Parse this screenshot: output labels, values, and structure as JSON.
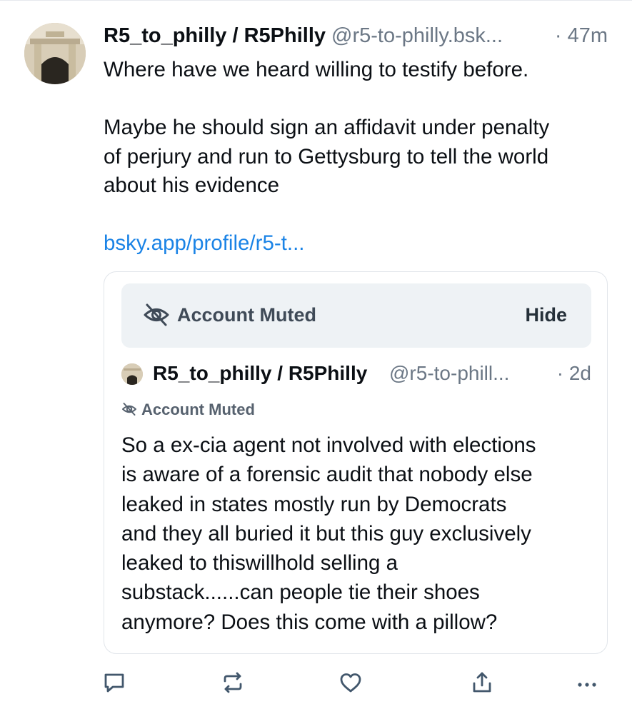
{
  "post": {
    "display_name": "R5_to_philly / R5Philly",
    "handle": "@r5-to-philly.bsk...",
    "time": "· 47m",
    "text_paragraph_1": "Where have we heard willing to testify before.",
    "text_paragraph_2_lines": [
      "Maybe he should sign an affidavit under penalty",
      "of perjury and run to Gettysburg to tell the world",
      "about his evidence"
    ],
    "link_text": "bsky.app/profile/r5-t..."
  },
  "embed": {
    "muted_label": "Account Muted",
    "hide_label": "Hide",
    "quote": {
      "display_name": "R5_to_philly / R5Philly",
      "handle": "@r5-to-phill...",
      "time": "· 2d",
      "muted_label": "Account Muted",
      "text_lines": [
        "So a ex-cia agent not involved with elections",
        "is aware of a forensic audit that nobody else",
        "leaked in states mostly run by Democrats",
        "and they all buried it but this guy exclusively",
        "leaked to thiswillhold selling a",
        "substack......can people tie their shoes",
        "anymore?  Does this come with a pillow?"
      ]
    }
  },
  "actions": [
    {
      "icon": "reply-icon"
    },
    {
      "icon": "repost-icon"
    },
    {
      "icon": "like-icon"
    },
    {
      "icon": "share-icon"
    },
    {
      "icon": "more-icon"
    }
  ],
  "colors": {
    "link": "#1a83e6",
    "muted_text": "#6b7785",
    "muted_bar_bg": "#eef2f5",
    "icon": "#42576c"
  }
}
